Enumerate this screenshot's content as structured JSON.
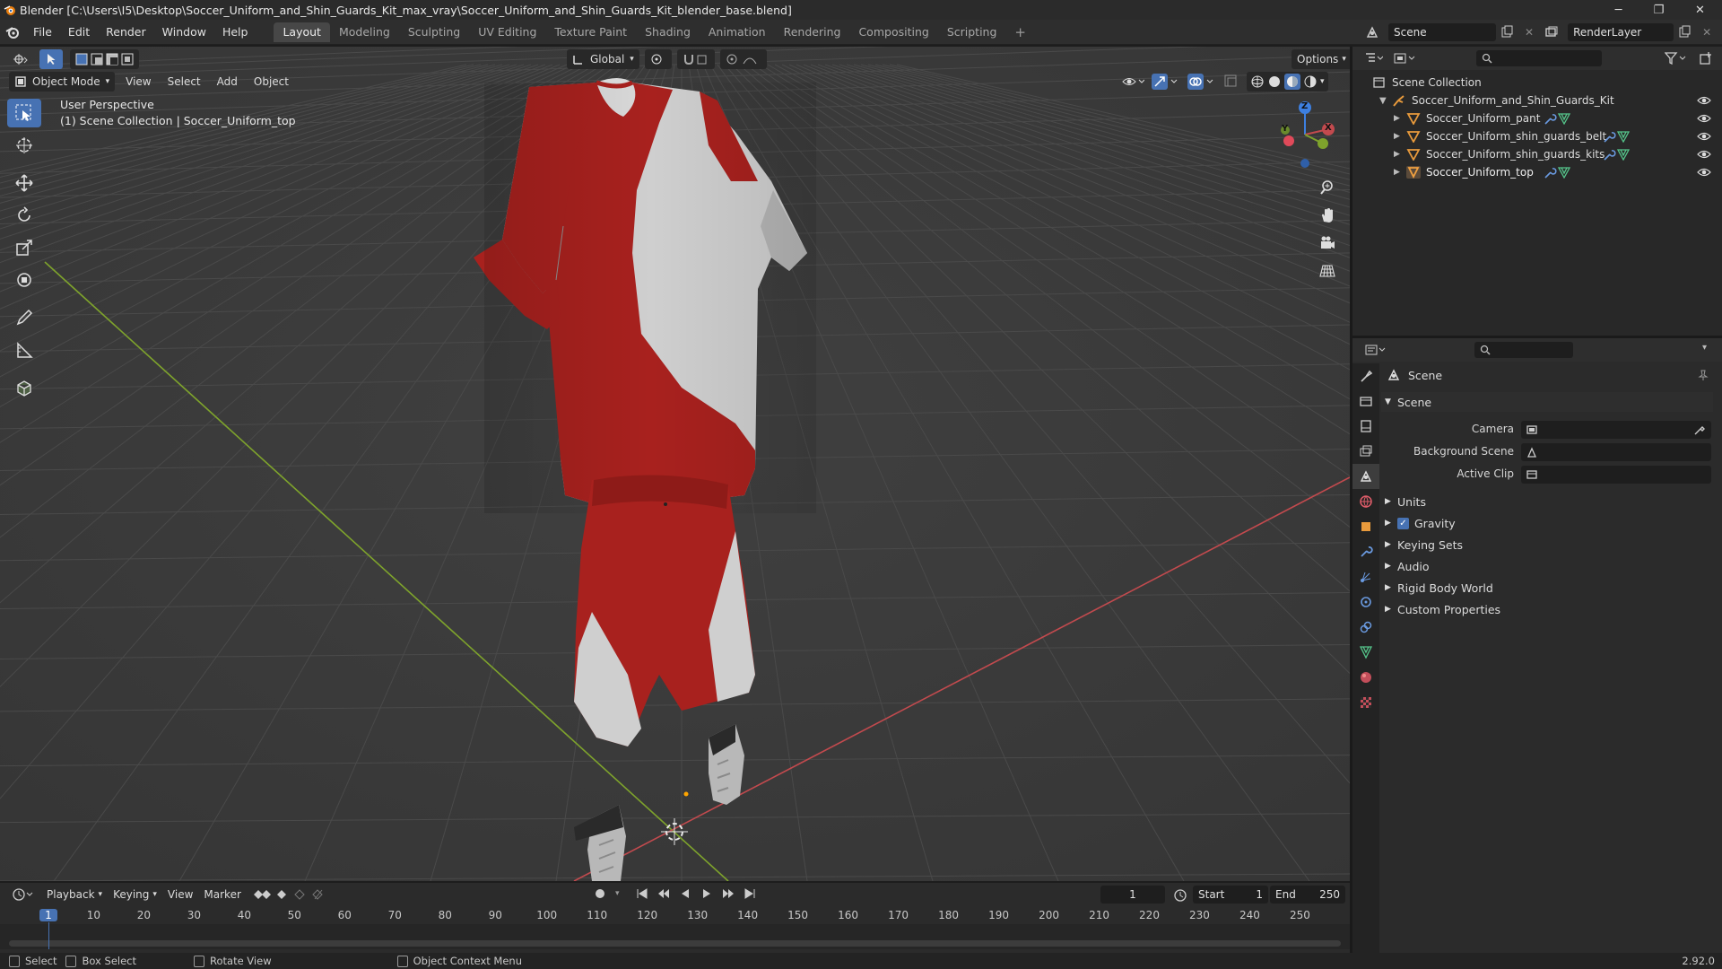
{
  "window": {
    "title": "Blender [C:\\Users\\I5\\Desktop\\Soccer_Uniform_and_Shin_Guards_Kit_max_vray\\Soccer_Uniform_and_Shin_Guards_Kit_blender_base.blend]",
    "minimize": "─",
    "maximize": "❐",
    "close": "✕"
  },
  "menu": {
    "items": [
      "File",
      "Edit",
      "Render",
      "Window",
      "Help"
    ]
  },
  "workspaces": {
    "tabs": [
      "Layout",
      "Modeling",
      "Sculpting",
      "UV Editing",
      "Texture Paint",
      "Shading",
      "Animation",
      "Rendering",
      "Compositing",
      "Scripting"
    ],
    "add": "+"
  },
  "scene_selector": {
    "value": "Scene"
  },
  "renderlayer_selector": {
    "value": "RenderLayer"
  },
  "viewport": {
    "mode": "Object Mode",
    "menus": [
      "View",
      "Select",
      "Add",
      "Object"
    ],
    "orientation": "Global",
    "options_label": "Options",
    "perspective_label": "User Perspective",
    "collection_label": "(1) Scene Collection | Soccer_Uniform_top",
    "gizmo": {
      "x": "X",
      "y": "Y",
      "z": "Z"
    }
  },
  "outliner": {
    "root": "Scene Collection",
    "collection": "Soccer_Uniform_and_Shin_Guards_Kit",
    "objects": [
      "Soccer_Uniform_pant",
      "Soccer_Uniform_shin_guards_belt",
      "Soccer_Uniform_shin_guards_kits",
      "Soccer_Uniform_top"
    ]
  },
  "properties": {
    "context": "Scene",
    "panel": "Scene",
    "fields": {
      "camera": "Camera",
      "background_scene": "Background Scene",
      "active_clip": "Active Clip"
    },
    "subpanels": [
      "Units",
      "Gravity",
      "Keying Sets",
      "Audio",
      "Rigid Body World",
      "Custom Properties"
    ],
    "gravity_checked": true
  },
  "timeline": {
    "menus": [
      "Playback",
      "Keying",
      "View",
      "Marker"
    ],
    "current_frame": "1",
    "start_label": "Start",
    "start_value": "1",
    "end_label": "End",
    "end_value": "250",
    "ruler": [
      "1",
      "10",
      "20",
      "30",
      "40",
      "50",
      "60",
      "70",
      "80",
      "90",
      "100",
      "110",
      "120",
      "130",
      "140",
      "150",
      "160",
      "170",
      "180",
      "190",
      "200",
      "210",
      "220",
      "230",
      "240",
      "250"
    ]
  },
  "statusbar": {
    "select": "Select",
    "box_select": "Box Select",
    "rotate": "Rotate View",
    "context_menu": "Object Context Menu",
    "version": "2.92.0"
  },
  "colors": {
    "accent": "#4772b3",
    "jersey_red": "#a8211e",
    "jersey_white": "#cfcfcf",
    "x_axis": "#c24a4e",
    "y_axis": "#7ea32c",
    "z_axis": "#3d7fe0"
  }
}
